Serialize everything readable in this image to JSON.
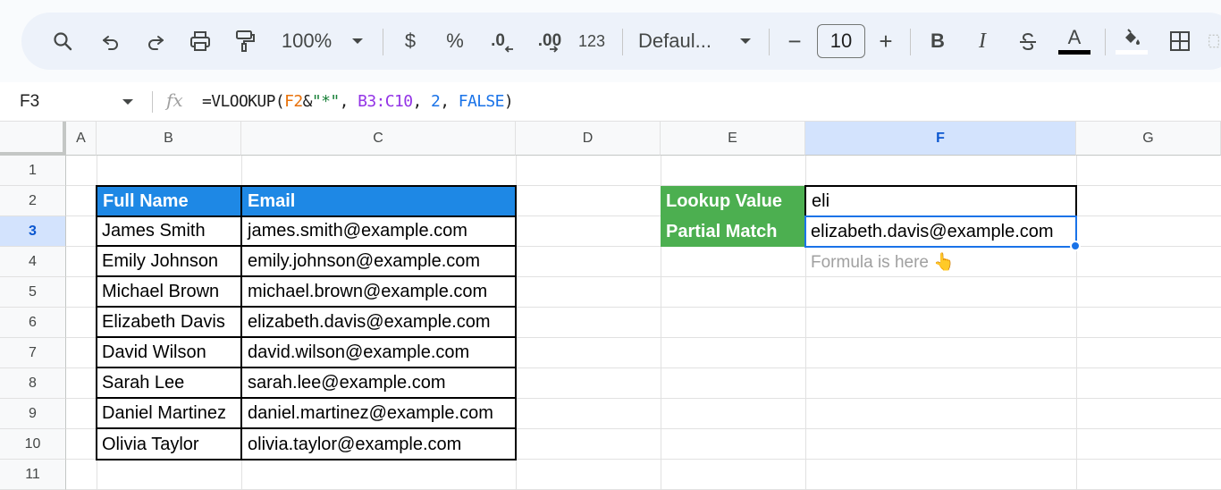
{
  "toolbar": {
    "zoom": "100%",
    "currency": "$",
    "percent": "%",
    "decrease_decimal": ".0",
    "increase_decimal": ".00",
    "number_format": "123",
    "font": "Defaul...",
    "font_size": "10",
    "minus": "−",
    "plus": "+",
    "bold": "B",
    "italic": "I",
    "text_color_letter": "A"
  },
  "formula_bar": {
    "cell_ref": "F3",
    "formula_parts": {
      "prefix": "=VLOOKUP(",
      "ref1": "F2",
      "amp": "&",
      "str": "\"*\"",
      "sep1": ", ",
      "range": "B3:C10",
      "sep2": ", ",
      "num": "2",
      "sep3": ", ",
      "bool": "FALSE",
      "suffix": ")"
    }
  },
  "columns": [
    "A",
    "B",
    "C",
    "D",
    "E",
    "F",
    "G"
  ],
  "rows": [
    "1",
    "2",
    "3",
    "4",
    "5",
    "6",
    "7",
    "8",
    "9",
    "10",
    "11"
  ],
  "selected_column": "F",
  "selected_row": "3",
  "table": {
    "headers": [
      "Full Name",
      "Email"
    ],
    "rows": [
      [
        "James Smith",
        "james.smith@example.com"
      ],
      [
        "Emily Johnson",
        "emily.johnson@example.com"
      ],
      [
        "Michael Brown",
        "michael.brown@example.com"
      ],
      [
        "Elizabeth Davis",
        "elizabeth.davis@example.com"
      ],
      [
        "David Wilson",
        "david.wilson@example.com"
      ],
      [
        "Sarah Lee",
        "sarah.lee@example.com"
      ],
      [
        "Daniel Martinez",
        "daniel.martinez@example.com"
      ],
      [
        "Olivia Taylor",
        "olivia.taylor@example.com"
      ]
    ]
  },
  "lookup": {
    "label1": "Lookup Value",
    "value1": "eli",
    "label2": "Partial Match",
    "value2": "elizabeth.davis@example.com",
    "note": "Formula is here 👆"
  },
  "colors": {
    "header_blue": "#1e88e5",
    "label_green": "#4caf50",
    "selection": "#1a73e8"
  }
}
